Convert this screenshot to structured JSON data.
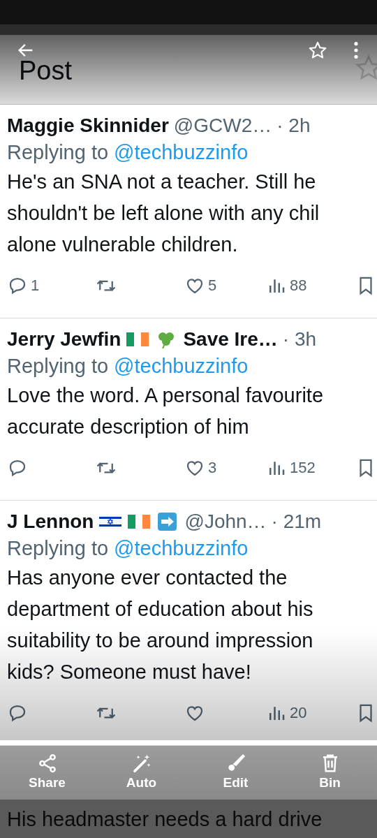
{
  "viewer": {
    "actions": [
      {
        "kind": "share",
        "label": "Share"
      },
      {
        "kind": "auto",
        "label": "Auto"
      },
      {
        "kind": "edit",
        "label": "Edit"
      },
      {
        "kind": "bin",
        "label": "Bin"
      }
    ]
  },
  "screenshot": {
    "title": "Post",
    "replies": [
      {
        "name_parts": [
          {
            "kind": "text",
            "text": "Maggie Skinnider"
          }
        ],
        "handle": "@GCW2…",
        "time": "· 2h",
        "replying_label": "Replying to",
        "replying_handle": "@techbuzzinfo",
        "lines": [
          "He's an SNA not a teacher. Still he",
          "shouldn't be left alone with any chil",
          "alone vulnerable children."
        ],
        "stats": {
          "replies": "1",
          "likes": "5",
          "views": "88"
        }
      },
      {
        "name_parts": [
          {
            "kind": "text",
            "text": "Jerry Jewfin"
          },
          {
            "kind": "flag-ie"
          },
          {
            "kind": "shamrock"
          },
          {
            "kind": "text",
            "text": "Save Ire…"
          }
        ],
        "time": "· 3h",
        "replying_label": "Replying to",
        "replying_handle": "@techbuzzinfo",
        "lines": [
          "Love the word. A personal favourite",
          "accurate description of him"
        ],
        "stats": {
          "likes": "3",
          "views": "152"
        }
      },
      {
        "name_parts": [
          {
            "kind": "text",
            "text": "J Lennon"
          },
          {
            "kind": "flag-il"
          },
          {
            "kind": "flag-ie"
          },
          {
            "kind": "arrow"
          }
        ],
        "handle": "@John…",
        "time": "· 21m",
        "replying_label": "Replying to",
        "replying_handle": "@techbuzzinfo",
        "lines": [
          "Has anyone ever contacted the",
          "department of education about his",
          "suitability to be around impression",
          "kids? Someone must have!"
        ],
        "stats": {
          "views": "20"
        }
      }
    ],
    "partial_reply": {
      "lines": [
        "His headmaster needs a hard drive"
      ]
    }
  }
}
